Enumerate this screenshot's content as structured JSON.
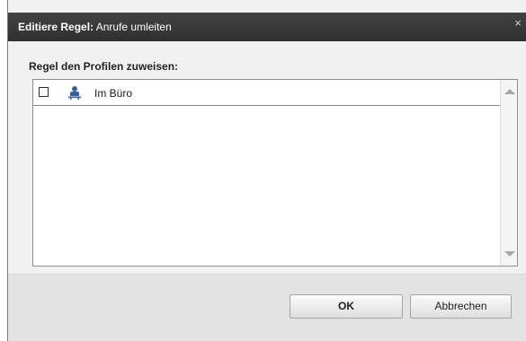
{
  "dialog": {
    "title_prefix": "Editiere Regel:",
    "title_name": "Anrufe umleiten",
    "close_glyph": "×"
  },
  "section": {
    "label": "Regel den Profilen zuweisen:"
  },
  "profiles": [
    {
      "label": "Im Büro",
      "checked": false,
      "icon": "profile-person-icon"
    }
  ],
  "buttons": {
    "ok": "OK",
    "cancel": "Abbrechen"
  },
  "colors": {
    "titlebar": "#3a3a3a",
    "profile_icon": "#3d5f9e"
  }
}
